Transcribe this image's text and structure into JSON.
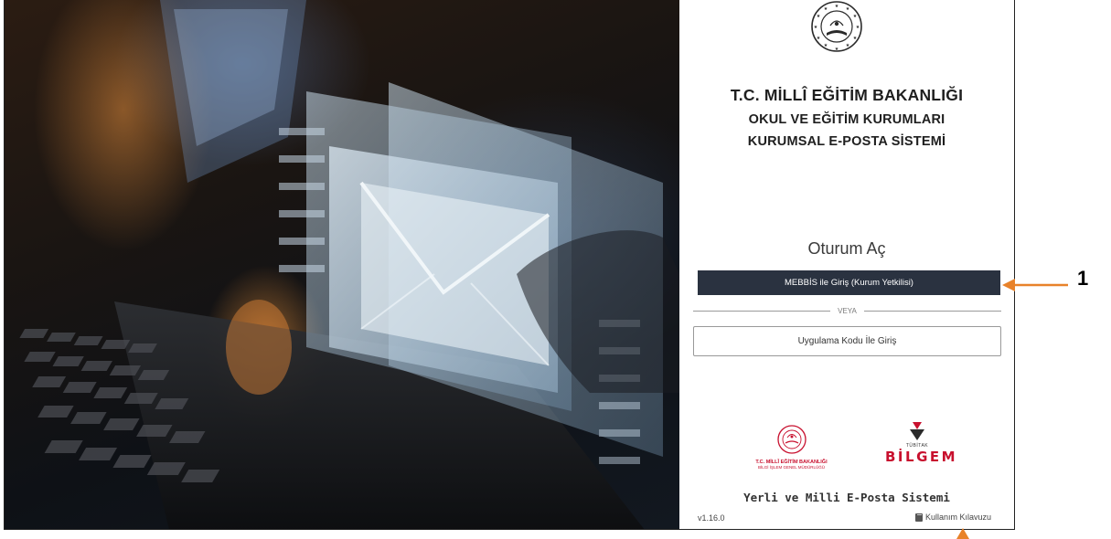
{
  "header": {
    "title_line1": "T.C. MİLLÎ EĞİTİM BAKANLIĞI",
    "title_line2": "OKUL VE EĞİTİM KURUMLARI",
    "title_line3": "KURUMSAL E-POSTA SİSTEMİ"
  },
  "login": {
    "title": "Oturum Aç",
    "mebbis_button": "MEBBİS ile Giriş (Kurum Yetkilisi)",
    "or_divider": "VEYA",
    "code_button": "Uygulama Kodu İle Giriş"
  },
  "logos": {
    "meb_line1": "T.C. MİLLÎ EĞİTİM BAKANLIĞI",
    "meb_line2": "BİLGİ İŞLEM GENEL MÜDÜRLÜĞÜ",
    "tubitak_text": "TÜBİTAK",
    "bilgem_text": "BİLGEM"
  },
  "footer": {
    "tagline": "Yerli ve Milli E-Posta Sistemi",
    "version": "v1.16.0",
    "guide_link": "Kullanım Kılavuzu",
    "guide_icon": "book-icon"
  },
  "annotations": {
    "marker_1": "1",
    "arrow_color": "#e8822a"
  },
  "colors": {
    "primary_button": "#2a3240",
    "brand_red": "#c8102e"
  }
}
